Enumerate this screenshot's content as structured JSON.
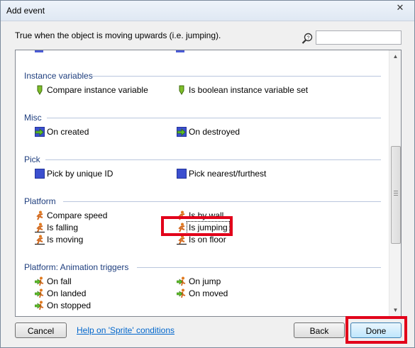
{
  "window": {
    "title": "Add event",
    "close_glyph": "✕"
  },
  "description": "True when the object is moving upwards (i.e. jumping).",
  "search": {
    "icon": "magnifier-help-icon",
    "value": "",
    "placeholder": ""
  },
  "sections": [
    {
      "title": "Instance variables",
      "items": [
        {
          "label": "Compare instance variable",
          "icon": "instance-variable-icon"
        },
        {
          "label": "Is boolean instance variable set",
          "icon": "instance-variable-icon"
        }
      ]
    },
    {
      "title": "Misc",
      "items": [
        {
          "label": "On created",
          "icon": "trigger-arrow-icon"
        },
        {
          "label": "On destroyed",
          "icon": "trigger-arrow-icon"
        }
      ]
    },
    {
      "title": "Pick",
      "items": [
        {
          "label": "Pick by unique ID",
          "icon": "pick-square-icon"
        },
        {
          "label": "Pick nearest/furthest",
          "icon": "pick-square-icon"
        }
      ]
    },
    {
      "title": "Platform",
      "items": [
        {
          "label": "Compare speed",
          "icon": "platform-runner-icon"
        },
        {
          "label": "Is by wall",
          "icon": "platform-runner-icon"
        },
        {
          "label": "Is falling",
          "icon": "platform-runner-icon"
        },
        {
          "label": "Is jumping",
          "icon": "platform-runner-icon",
          "selected": true
        },
        {
          "label": "Is moving",
          "icon": "platform-runner-icon"
        },
        {
          "label": "Is on floor",
          "icon": "platform-runner-icon"
        }
      ]
    },
    {
      "title": "Platform: Animation triggers",
      "items": [
        {
          "label": "On fall",
          "icon": "platform-trigger-icon"
        },
        {
          "label": "On jump",
          "icon": "platform-trigger-icon"
        },
        {
          "label": "On landed",
          "icon": "platform-trigger-icon"
        },
        {
          "label": "On moved",
          "icon": "platform-trigger-icon"
        },
        {
          "label": "On stopped",
          "icon": "platform-trigger-icon"
        }
      ]
    }
  ],
  "footer": {
    "cancel_label": "Cancel",
    "help_link": "Help on 'Sprite' conditions",
    "back_label": "Back",
    "done_label": "Done"
  },
  "colors": {
    "section_title": "#1e3e7e",
    "highlight": "#e2001a",
    "link": "#0066cc"
  }
}
